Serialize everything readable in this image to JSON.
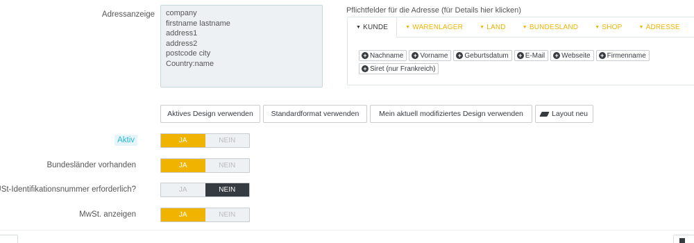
{
  "address_format": {
    "label": "Adressanzeige",
    "lines": [
      "company",
      "firstname lastname",
      "address1",
      "address2",
      "postcode city",
      "Country:name"
    ]
  },
  "required_fields": {
    "title": "Pflichtfelder für die Adresse (für Details hier klicken)",
    "tabs": [
      {
        "label": "KUNDE",
        "active": true
      },
      {
        "label": "WARENLAGER",
        "active": false
      },
      {
        "label": "LAND",
        "active": false
      },
      {
        "label": "BUNDESLAND",
        "active": false
      },
      {
        "label": "SHOP",
        "active": false
      },
      {
        "label": "ADRESSE",
        "active": false
      }
    ],
    "fields": [
      "Nachname",
      "Vorname",
      "Geburtsdatum",
      "E-Mail",
      "Webseite",
      "Firmenname",
      "Siret (nur Frankreich)"
    ]
  },
  "design_buttons": {
    "active": "Aktives Design verwenden",
    "standard": "Standardformat verwenden",
    "modified": "Mein aktuell modifiziertes Design verwenden",
    "reset": "Layout neu"
  },
  "switch_labels": {
    "yes": "JA",
    "no": "NEIN"
  },
  "settings": [
    {
      "label": "Aktiv",
      "value": "JA"
    },
    {
      "label": "Bundesländer vorhanden",
      "value": "JA"
    },
    {
      "label": "USt-Identifikationsnummer erforderlich?",
      "value": "NEIN"
    },
    {
      "label": "MwSt. anzeigen",
      "value": "JA"
    }
  ],
  "colors": {
    "accent": "#f0b400",
    "dark": "#363a41",
    "info": "#25b9d7"
  }
}
